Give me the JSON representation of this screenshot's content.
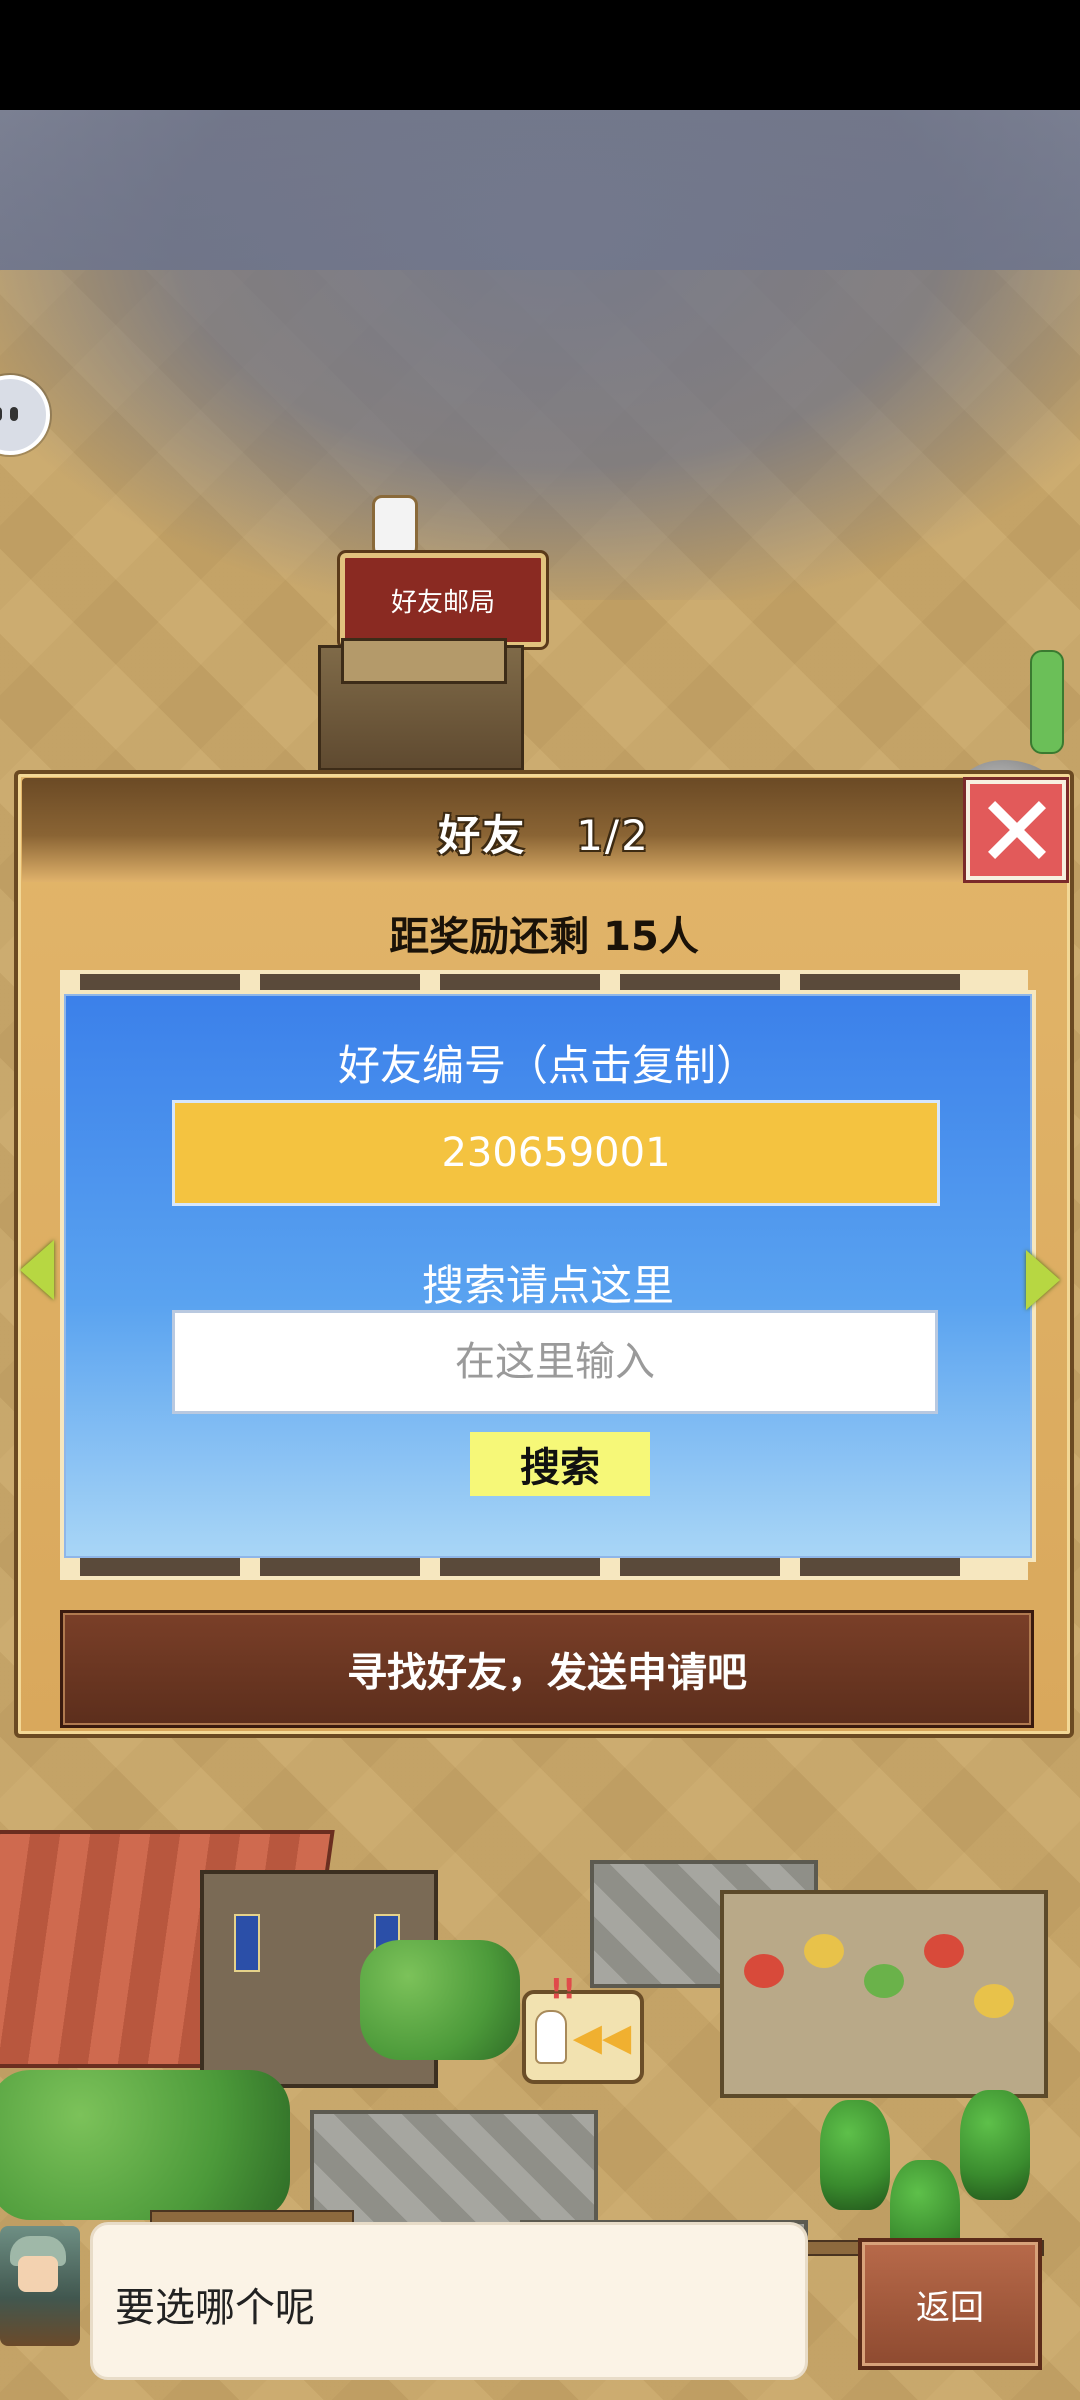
{
  "map": {
    "post_office_sign": "好友邮局"
  },
  "dialog": {
    "title": "好友",
    "page_indicator": "1/2",
    "reward_text": "距奖励还剩 15人",
    "friend_code_label": "好友编号（点击复制）",
    "friend_code_value": "230659001",
    "search_label": "搜索请点这里",
    "search_placeholder": "在这里输入",
    "search_button": "搜索",
    "send_request_text": "寻找好友，发送申请吧"
  },
  "footer": {
    "message": "要选哪个呢",
    "back_button": "返回"
  },
  "colors": {
    "dialog_bg": "#d9a85c",
    "blue_panel": "#3b80ea",
    "code_box": "#f4c340",
    "search_button": "#f6f878",
    "close_button": "#e25a5a",
    "send_bar": "#5c2e1c",
    "arrow": "#b7d742"
  },
  "icons": {
    "close": "close-icon",
    "prev": "arrow-left-icon",
    "next": "arrow-right-icon",
    "pointer": "pointing-hand-icon",
    "chat_bubble": "chat-bubble-icon"
  }
}
